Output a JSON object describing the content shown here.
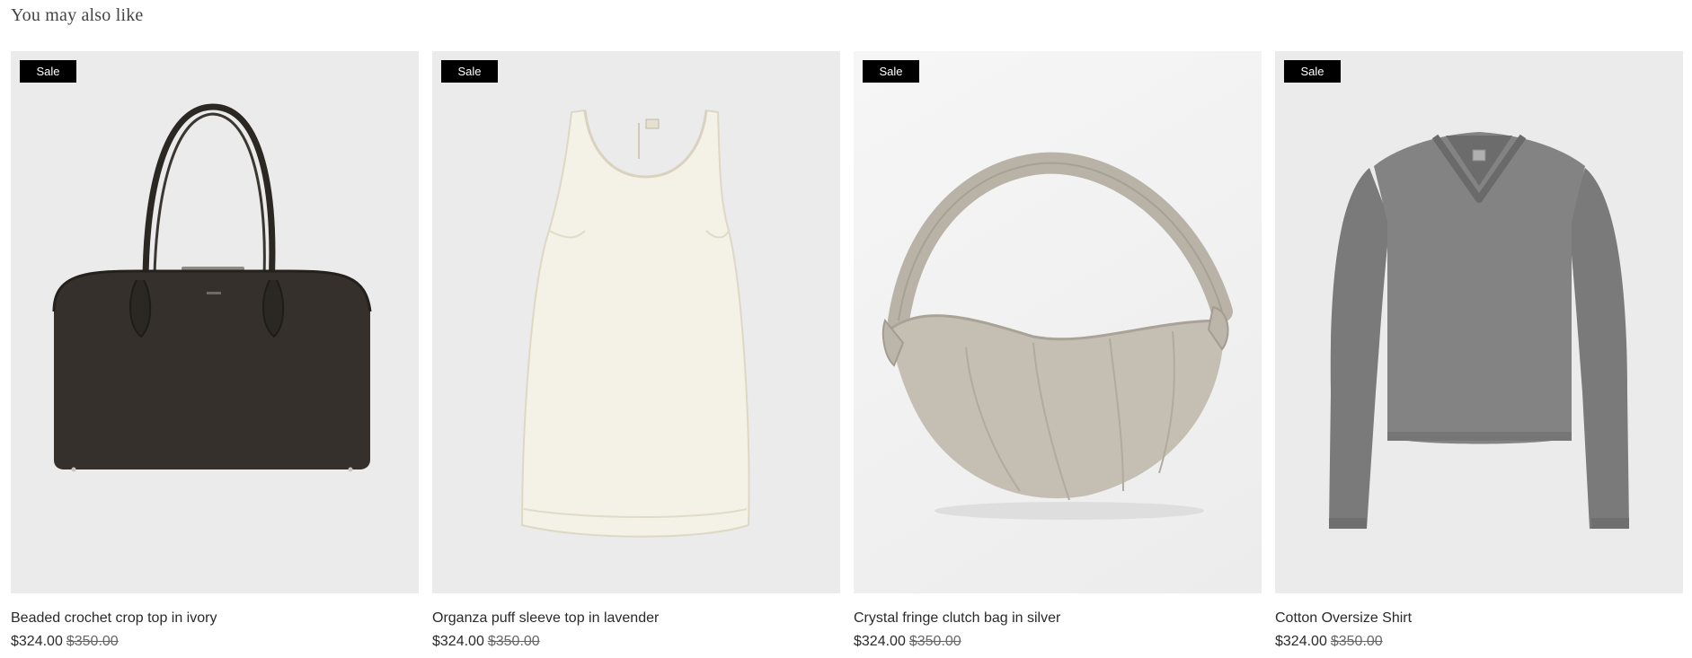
{
  "section": {
    "title": "You may also like"
  },
  "products": [
    {
      "name": "Beaded crochet crop top in ivory",
      "badge": "Sale",
      "price": "$324.00",
      "compare_price": "$350.00",
      "image_icon": "leather-tote-bag-image",
      "image_bg": "#ebebeb"
    },
    {
      "name": "Organza puff sleeve top in lavender",
      "badge": "Sale",
      "price": "$324.00",
      "compare_price": "$350.00",
      "image_icon": "ivory-dress-image",
      "image_bg": "#ebebeb"
    },
    {
      "name": "Crystal fringe clutch bag in silver",
      "badge": "Sale",
      "price": "$324.00",
      "compare_price": "$350.00",
      "image_icon": "crescent-shoulder-bag-image",
      "image_bg": "#f1f1f1"
    },
    {
      "name": "Cotton Oversize Shirt",
      "badge": "Sale",
      "price": "$324.00",
      "compare_price": "$350.00",
      "image_icon": "grey-sweater-image",
      "image_bg": "#ebebeb"
    }
  ],
  "colors": {
    "badge_bg": "#000000",
    "badge_text": "#ffffff",
    "text": "#2a2a2a"
  }
}
